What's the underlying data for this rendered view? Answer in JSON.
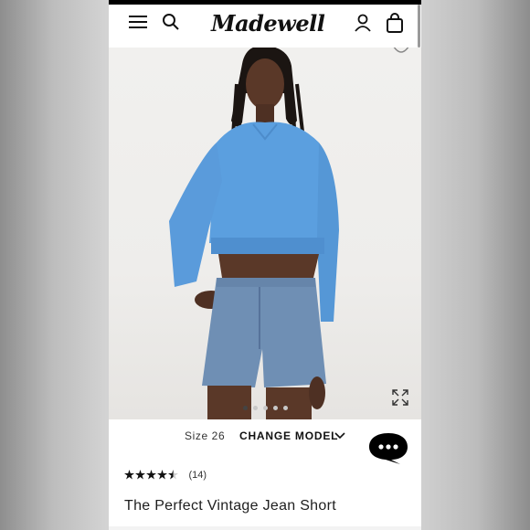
{
  "header": {
    "logo_text": "Madewell",
    "icons": [
      "menu-icon",
      "search-icon",
      "account-icon",
      "shopping-bag-icon"
    ]
  },
  "gallery": {
    "image_description_icon": "product-photo",
    "slide_count": 5,
    "active_slide": 1
  },
  "size_row": {
    "size_label": "Size 26",
    "change_model_label": "CHANGE MODEL"
  },
  "rating": {
    "stars": 4.5,
    "max_stars": 5,
    "review_count": "(14)"
  },
  "product": {
    "title": "The Perfect Vintage Jean Short"
  },
  "colors": {
    "sweatshirt": "#5b9fdf",
    "denim": "#6f8fb4",
    "text": "#111111",
    "chat_bubble": "#000000"
  }
}
